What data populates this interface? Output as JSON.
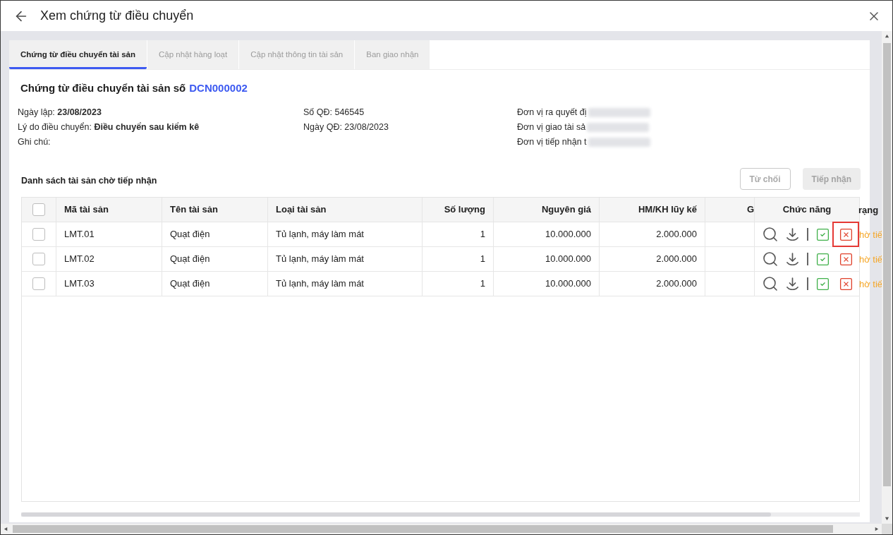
{
  "window": {
    "title": "Xem chứng từ điều chuyển"
  },
  "tabs": [
    {
      "label": "Chứng từ điều chuyển tài sản",
      "selected": true
    },
    {
      "label": "Cập nhật hàng loạt",
      "selected": false
    },
    {
      "label": "Cập nhật thông tin tài sản",
      "selected": false
    },
    {
      "label": "Ban giao nhận",
      "selected": false
    }
  ],
  "document": {
    "heading": "Chứng từ điều chuyển tài sản số",
    "number": "DCN000002"
  },
  "info_columns": [
    {
      "lines": [
        {
          "text": "Ngày lập: **23/08/2023**",
          "blurred": false
        },
        {
          "text": "Lý do điều chuyển: **Điều chuyển sau kiểm kê**",
          "blurred": false
        },
        {
          "text": "Ghi chú:",
          "blurred": false
        }
      ]
    },
    {
      "lines": [
        {
          "text": "Số QĐ: 546545",
          "blurred": false
        },
        {
          "text": "Ngày QĐ: 23/08/2023",
          "blurred": false
        }
      ]
    },
    {
      "lines": [
        {
          "text": "Đơn vị ra quyết đị",
          "blurred": true
        },
        {
          "text": "Đơn vị giao tài sả",
          "blurred": true
        },
        {
          "text": "Đơn vị tiếp nhận t",
          "blurred": true
        }
      ]
    }
  ],
  "list": {
    "title": "Danh sách tài sản chờ tiếp nhận",
    "buttons": [
      {
        "label": "Từ chối",
        "kind": "outline",
        "disabled": true
      },
      {
        "label": "Tiếp nhận",
        "kind": "filled",
        "disabled": true
      }
    ]
  },
  "table": {
    "select_all_checked": false,
    "columns": [
      "Mã tài sản",
      "Tên tài sản",
      "Loại tài sản",
      "Số lượng",
      "Nguyên giá",
      "HM/KH lũy kế",
      "G",
      "Chức năng",
      "rạng"
    ],
    "rows": [
      {
        "checked": false,
        "cells": [
          "LMT.01",
          "Quạt điện",
          "Tủ lạnh, máy làm mát",
          "1",
          "10.000.000",
          "2.000.000"
        ],
        "reject_highlighted": true,
        "status": "hờ tiế"
      },
      {
        "checked": false,
        "cells": [
          "LMT.02",
          "Quạt điện",
          "Tủ lạnh, máy làm mát",
          "1",
          "10.000.000",
          "2.000.000"
        ],
        "reject_highlighted": false,
        "status": "hờ tiế"
      },
      {
        "checked": false,
        "cells": [
          "LMT.03",
          "Quạt điện",
          "Tủ lạnh, máy làm mát",
          "1",
          "10.000.000",
          "2.000.000"
        ],
        "reject_highlighted": false,
        "status": "hờ tiế"
      }
    ]
  }
}
